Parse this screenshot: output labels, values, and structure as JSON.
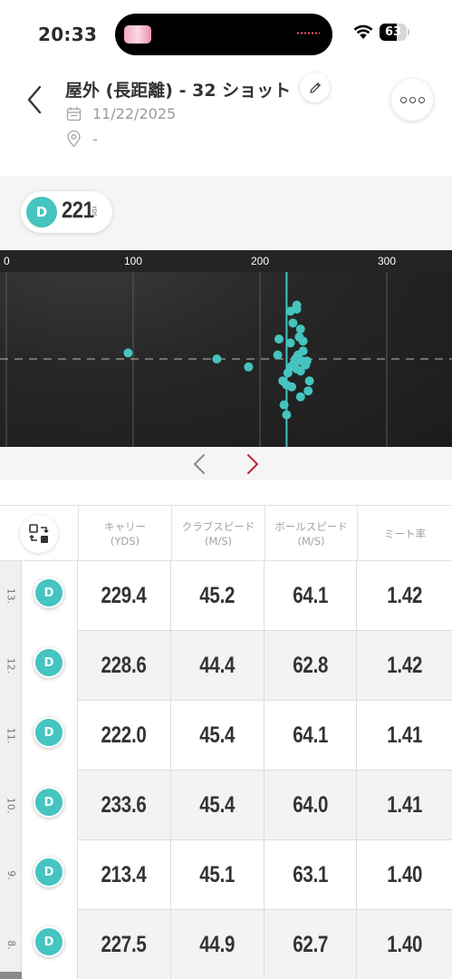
{
  "status_bar": {
    "time": "20:33",
    "battery_level": 63,
    "battery_text": "63"
  },
  "header": {
    "title": "屋外 (長距離) - 32 ショット",
    "date": "11/22/2025",
    "location": "-"
  },
  "club": {
    "badge": "D",
    "distance": "221",
    "unit": "YDS"
  },
  "chart_data": {
    "type": "scatter",
    "x_ticks": [
      0,
      100,
      200,
      300
    ],
    "x_tick_labels": [
      "0",
      "100",
      "200",
      "300"
    ],
    "xlim": [
      0,
      352
    ],
    "ylim": [
      -40,
      45
    ],
    "grid": true,
    "average_carry": 221,
    "point_color": "#45c4c0",
    "line_color": "#45c4c0",
    "points": [
      {
        "x": 96,
        "y": 3
      },
      {
        "x": 166,
        "y": 0
      },
      {
        "x": 191,
        "y": -4
      },
      {
        "x": 214,
        "y": 2
      },
      {
        "x": 215,
        "y": 10
      },
      {
        "x": 218,
        "y": -11
      },
      {
        "x": 219,
        "y": -23
      },
      {
        "x": 221,
        "y": -28
      },
      {
        "x": 222,
        "y": -7
      },
      {
        "x": 224,
        "y": 24
      },
      {
        "x": 224,
        "y": 8
      },
      {
        "x": 224,
        "y": -4
      },
      {
        "x": 225,
        "y": -14
      },
      {
        "x": 226,
        "y": 18
      },
      {
        "x": 227,
        "y": -2
      },
      {
        "x": 228,
        "y": 0
      },
      {
        "x": 229,
        "y": -5
      },
      {
        "x": 229,
        "y": 25
      },
      {
        "x": 230,
        "y": 2
      },
      {
        "x": 231,
        "y": 11
      },
      {
        "x": 232,
        "y": -6
      },
      {
        "x": 232,
        "y": -19
      },
      {
        "x": 232,
        "y": 15
      },
      {
        "x": 233,
        "y": -1
      },
      {
        "x": 234,
        "y": 4
      },
      {
        "x": 234,
        "y": 9
      },
      {
        "x": 236,
        "y": -3
      },
      {
        "x": 237,
        "y": -1
      },
      {
        "x": 238,
        "y": -16
      },
      {
        "x": 239,
        "y": -11
      },
      {
        "x": 221,
        "y": -13
      },
      {
        "x": 229,
        "y": 27
      }
    ]
  },
  "table": {
    "headers": [
      {
        "label": "キャリー",
        "unit": "(YDS)"
      },
      {
        "label": "クラブスピード",
        "unit": "(M/S)"
      },
      {
        "label": "ボールスピード",
        "unit": "(M/S)"
      },
      {
        "label": "ミート率",
        "unit": ""
      }
    ],
    "rows": [
      {
        "index": "13.",
        "club": "D",
        "carry": "229.4",
        "club_speed": "45.2",
        "ball_speed": "64.1",
        "smash": "1.42"
      },
      {
        "index": "12.",
        "club": "D",
        "carry": "228.6",
        "club_speed": "44.4",
        "ball_speed": "62.8",
        "smash": "1.42"
      },
      {
        "index": "11.",
        "club": "D",
        "carry": "222.0",
        "club_speed": "45.4",
        "ball_speed": "64.1",
        "smash": "1.41"
      },
      {
        "index": "10.",
        "club": "D",
        "carry": "233.6",
        "club_speed": "45.4",
        "ball_speed": "64.0",
        "smash": "1.41"
      },
      {
        "index": "9.",
        "club": "D",
        "carry": "213.4",
        "club_speed": "45.1",
        "ball_speed": "63.1",
        "smash": "1.40"
      },
      {
        "index": "8.",
        "club": "D",
        "carry": "227.5",
        "club_speed": "44.9",
        "ball_speed": "62.7",
        "smash": "1.40"
      }
    ]
  }
}
